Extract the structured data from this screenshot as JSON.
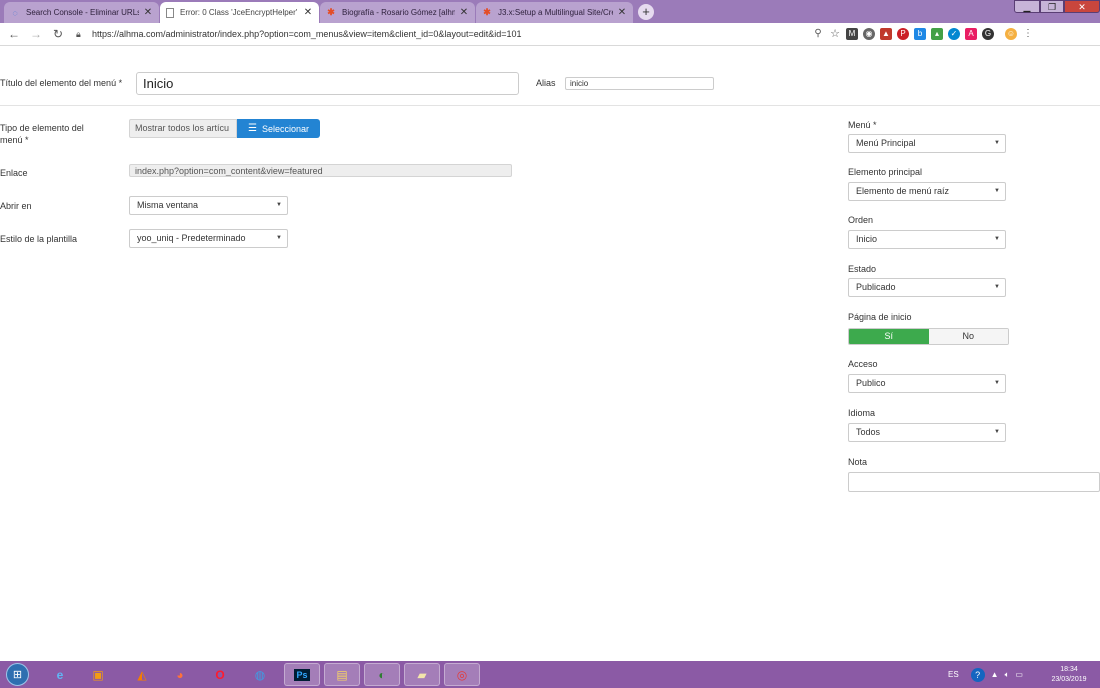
{
  "browser": {
    "tabs": [
      {
        "title": "Search Console - Eliminar URLs",
        "active": false
      },
      {
        "title": "Error: 0 Class 'JceEncryptHelper'",
        "active": true
      },
      {
        "title": "Biografía - Rosario Gómez [alhm",
        "active": false
      },
      {
        "title": "J3.x:Setup a Multilingual Site/Cre",
        "active": false
      }
    ],
    "close_glyph": "✕",
    "new_tab_glyph": "+",
    "url": "https://alhma.com/administrator/index.php?option=com_menus&view=item&client_id=0&layout=edit&id=101"
  },
  "form": {
    "title_label": "Título del elemento del menú *",
    "title_value": "Inicio",
    "alias_label": "Alias",
    "alias_value": "inicio",
    "type_label": "Tipo de elemento del menú *",
    "type_value": "Mostrar todos los artícu",
    "select_button": "Seleccionar",
    "link_label": "Enlace",
    "link_value": "index.php?option=com_content&view=featured",
    "open_label": "Abrir en",
    "open_value": "Misma ventana",
    "style_label": "Estilo de la plantilla",
    "style_value": "yoo_uniq - Predeterminado"
  },
  "sidebar": {
    "menu_label": "Menú *",
    "menu_value": "Menú Principal",
    "parent_label": "Elemento principal",
    "parent_value": "Elemento de menú raíz",
    "order_label": "Orden",
    "order_value": "Inicio",
    "status_label": "Estado",
    "status_value": "Publicado",
    "home_label": "Página de inicio",
    "home_yes": "Sí",
    "home_no": "No",
    "access_label": "Acceso",
    "access_value": "Publico",
    "language_label": "Idioma",
    "language_value": "Todos",
    "note_label": "Nota"
  },
  "taskbar": {
    "lang": "ES",
    "time": "18:34",
    "date": "23/03/2019"
  },
  "colors": {
    "tabbar": "#9b7bb9",
    "taskbar": "#8b5aa5",
    "primary_button": "#2384d3",
    "toggle_on": "#3daa4d"
  }
}
